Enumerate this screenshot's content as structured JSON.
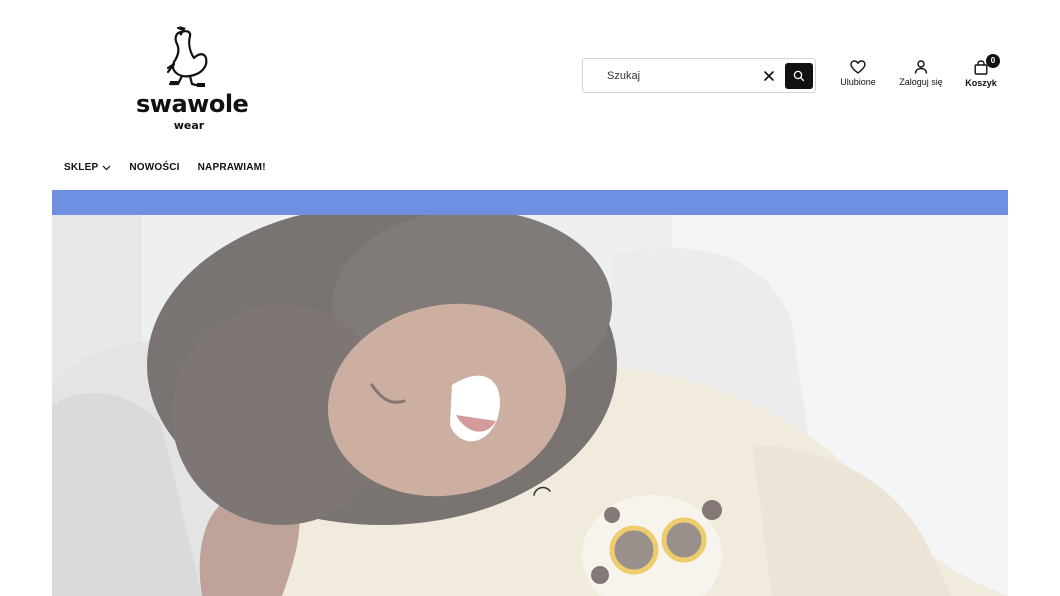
{
  "header": {
    "logo": {
      "brand": "swawole",
      "sub": "wear"
    },
    "search": {
      "placeholder": "Szukaj",
      "value": ""
    },
    "actions": {
      "favorites_label": "Ulubione",
      "login_label": "Zaloguj się",
      "cart_label": "Koszyk",
      "cart_count": "0"
    }
  },
  "nav": {
    "items": [
      {
        "label": "SKLEP",
        "has_dropdown": true
      },
      {
        "label": "NOWOŚCI"
      },
      {
        "label": "NAPRAWIAM!"
      }
    ]
  },
  "promo_bar": {
    "color": "#6f8fe3"
  },
  "hero": {
    "image": "child-laughing-in-cream-sweatshirt-with-dalmatian-print",
    "loading": true
  },
  "colors": {
    "accent": "#111111",
    "promo": "#6f8fe3"
  }
}
